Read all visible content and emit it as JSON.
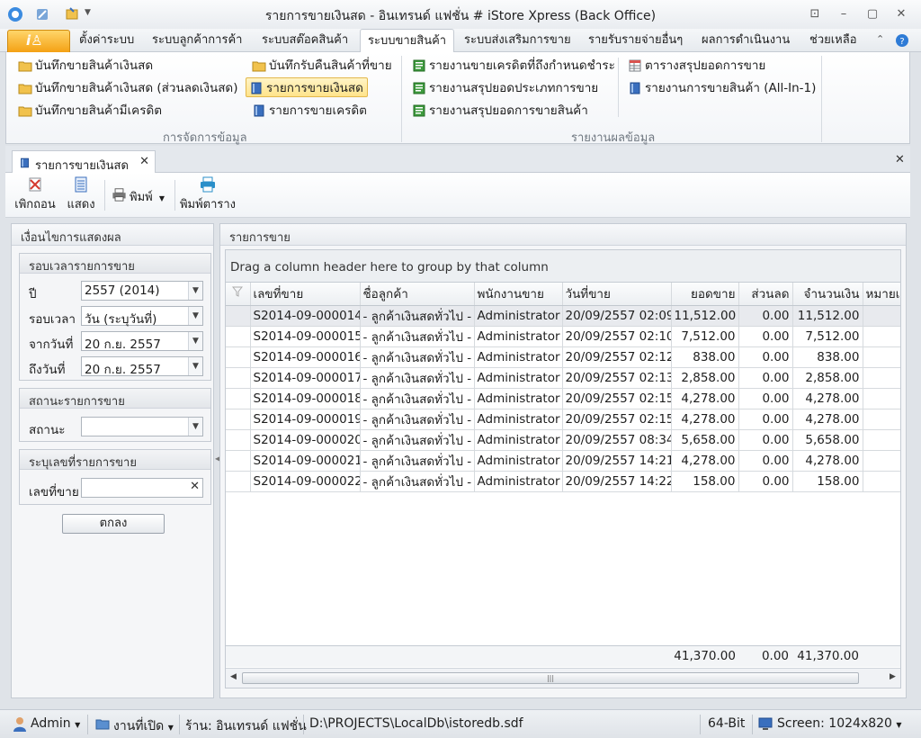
{
  "window": {
    "title": "รายการขายเงินสด - อินเทรนด์ แฟชั่น # iStore Xpress (Back Office)"
  },
  "ribbon_tabs": [
    "ตั้งค่าระบบ",
    "ระบบลูกค้าการค้า",
    "ระบบสต๊อคสินค้า",
    "ระบบขายสินค้า",
    "ระบบส่งเสริมการขาย",
    "รายรับรายจ่ายอื่นๆ",
    "ผลการดำเนินงาน",
    "ช่วยเหลือ"
  ],
  "ribbon": {
    "group1": {
      "label": "การจัดการข้อมูล",
      "items": [
        "บันทึกขายสินค้าเงินสด",
        "บันทึกขายสินค้าเงินสด (ส่วนลดเงินสด)",
        "บันทึกขายสินค้ามีเครดิต",
        "บันทึกรับคืนสินค้าที่ขาย",
        "รายการขายเงินสด",
        "รายการขายเครดิต"
      ]
    },
    "group2": {
      "label": "รายงานผลข้อมูล",
      "items": [
        "รายงานขายเครดิตที่ถึงกำหนดชำระ",
        "รายงานสรุปยอดประเภทการขาย",
        "รายงานสรุปยอดการขายสินค้า",
        "ตารางสรุปยอดการขาย",
        "รายงานการขายสินค้า (All-In-1)"
      ]
    }
  },
  "doc_tab": {
    "label": "รายการขายเงินสด"
  },
  "toolbar": {
    "cancel": "เพิกถอน",
    "show": "แสดง",
    "print": "พิมพ์",
    "print_table": "พิมพ์ตาราง"
  },
  "filter_panel": {
    "title": "เงื่อนไขการแสดงผล",
    "period": {
      "title": "รอบเวลารายการขาย",
      "year_label": "ปี",
      "year_value": "2557 (2014)",
      "period_label": "รอบเวลา",
      "period_value": "วัน (ระบุวันที่)",
      "from_label": "จากวันที่",
      "from_value": "20 ก.ย. 2557",
      "to_label": "ถึงวันที่",
      "to_value": "20 ก.ย. 2557"
    },
    "status": {
      "title": "สถานะรายการขาย",
      "label": "สถานะ",
      "value": ""
    },
    "number": {
      "title": "ระบุเลขที่รายการขาย",
      "label": "เลขที่ขาย",
      "value": ""
    },
    "ok_button": "ตกลง"
  },
  "grid_panel": {
    "title": "รายการขาย",
    "group_hint": "Drag a column header here to group by that column",
    "columns": [
      "เลขที่ขาย",
      "ชื่อลูกค้า",
      "พนักงานขาย",
      "วันที่ขาย",
      "ยอดขาย",
      "ส่วนลด",
      "จำนวนเงิน",
      "หมายเห"
    ],
    "rows": [
      [
        "S2014-09-000014",
        "- ลูกค้าเงินสดทั่วไป -",
        "Administrator",
        "20/09/2557 02:09",
        "11,512.00",
        "0.00",
        "11,512.00"
      ],
      [
        "S2014-09-000015",
        "- ลูกค้าเงินสดทั่วไป -",
        "Administrator",
        "20/09/2557 02:10",
        "7,512.00",
        "0.00",
        "7,512.00"
      ],
      [
        "S2014-09-000016",
        "- ลูกค้าเงินสดทั่วไป -",
        "Administrator",
        "20/09/2557 02:12",
        "838.00",
        "0.00",
        "838.00"
      ],
      [
        "S2014-09-000017",
        "- ลูกค้าเงินสดทั่วไป -",
        "Administrator",
        "20/09/2557 02:13",
        "2,858.00",
        "0.00",
        "2,858.00"
      ],
      [
        "S2014-09-000018",
        "- ลูกค้าเงินสดทั่วไป -",
        "Administrator",
        "20/09/2557 02:15",
        "4,278.00",
        "0.00",
        "4,278.00"
      ],
      [
        "S2014-09-000019",
        "- ลูกค้าเงินสดทั่วไป -",
        "Administrator",
        "20/09/2557 02:15",
        "4,278.00",
        "0.00",
        "4,278.00"
      ],
      [
        "S2014-09-000020",
        "- ลูกค้าเงินสดทั่วไป -",
        "Administrator",
        "20/09/2557 08:34",
        "5,658.00",
        "0.00",
        "5,658.00"
      ],
      [
        "S2014-09-000021",
        "- ลูกค้าเงินสดทั่วไป -",
        "Administrator",
        "20/09/2557 14:21",
        "4,278.00",
        "0.00",
        "4,278.00"
      ],
      [
        "S2014-09-000022",
        "- ลูกค้าเงินสดทั่วไป -",
        "Administrator",
        "20/09/2557 14:22",
        "158.00",
        "0.00",
        "158.00"
      ]
    ],
    "totals": {
      "sales": "41,370.00",
      "discount": "0.00",
      "amount": "41,370.00"
    },
    "scroll_grip": "|||"
  },
  "statusbar": {
    "user": "Admin",
    "open_work": "งานที่เปิด",
    "shop": "ร้าน: อินเทรนด์ แฟชั่น",
    "db_path": "D:\\PROJECTS\\LocalDb\\istoredb.sdf",
    "bits": "64-Bit",
    "screen": "Screen: 1024x820"
  },
  "colors": {
    "accent": "#f4a114",
    "highlight": "#ffe38a",
    "selected_row": "#e8eaee"
  }
}
